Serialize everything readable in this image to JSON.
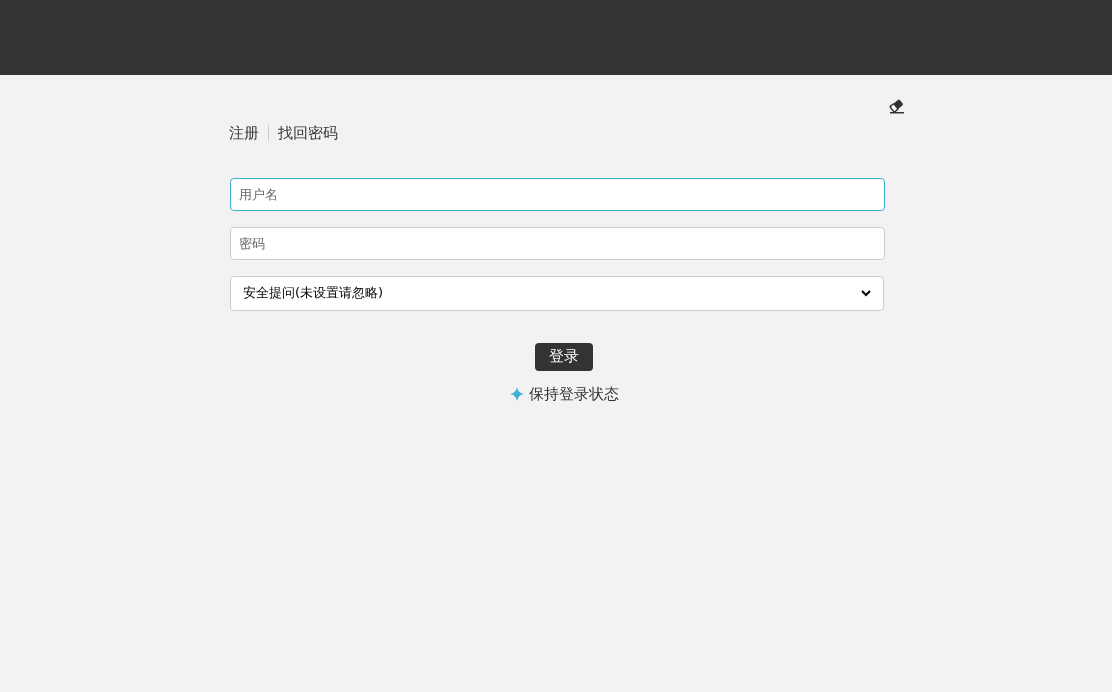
{
  "links": [
    {
      "label": "注册"
    },
    {
      "label": "找回密码"
    }
  ],
  "fields": [
    {
      "placeholder": "用户名",
      "focused": true
    },
    {
      "placeholder": "密码",
      "focused": false
    }
  ],
  "security_question": {
    "value": "安全提问(未设置请忽略)"
  },
  "login_button": "登录",
  "remember_login": "保持登录状态"
}
